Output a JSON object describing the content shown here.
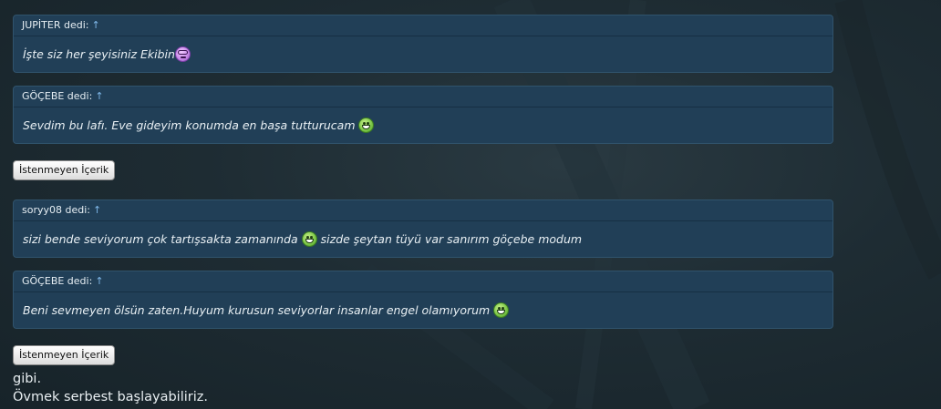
{
  "quotes": [
    {
      "author": "JUPİTER dedi:",
      "arrow": "↑",
      "text": "İşte siz her şeyisiniz Ekibin",
      "emoji": "nerd-smiley",
      "after": ""
    },
    {
      "author": "GÖÇEBE dedi:",
      "arrow": "↑",
      "text": "Sevdim bu lafı. Eve gideyim konumda en başa tutturucam ",
      "emoji": "grin-smiley",
      "after": ""
    },
    {
      "author": "soryy08 dedi:",
      "arrow": "↑",
      "text": "sizi bende seviyorum çok tartışsakta zamanında ",
      "emoji": "grin-smiley",
      "after": " sizde şeytan tüyü var sanırım göçebe modum"
    },
    {
      "author": "GÖÇEBE dedi:",
      "arrow": "↑",
      "text": "Beni sevmeyen ölsün zaten.Huyum kurusun seviyorlar insanlar engel olamıyorum ",
      "emoji": "grin-smiley",
      "after": ""
    }
  ],
  "buttons": {
    "unwanted_content_1": "İstenmeyen İçerik",
    "unwanted_content_2": "İstenmeyen İçerik"
  },
  "footer_lines": [
    "gibi.",
    "Övmek serbest başlayabiliriz."
  ],
  "colors": {
    "quote_bg": "#213f57",
    "arrow": "#7fb7e8",
    "page_bg": "#1e2c33"
  }
}
